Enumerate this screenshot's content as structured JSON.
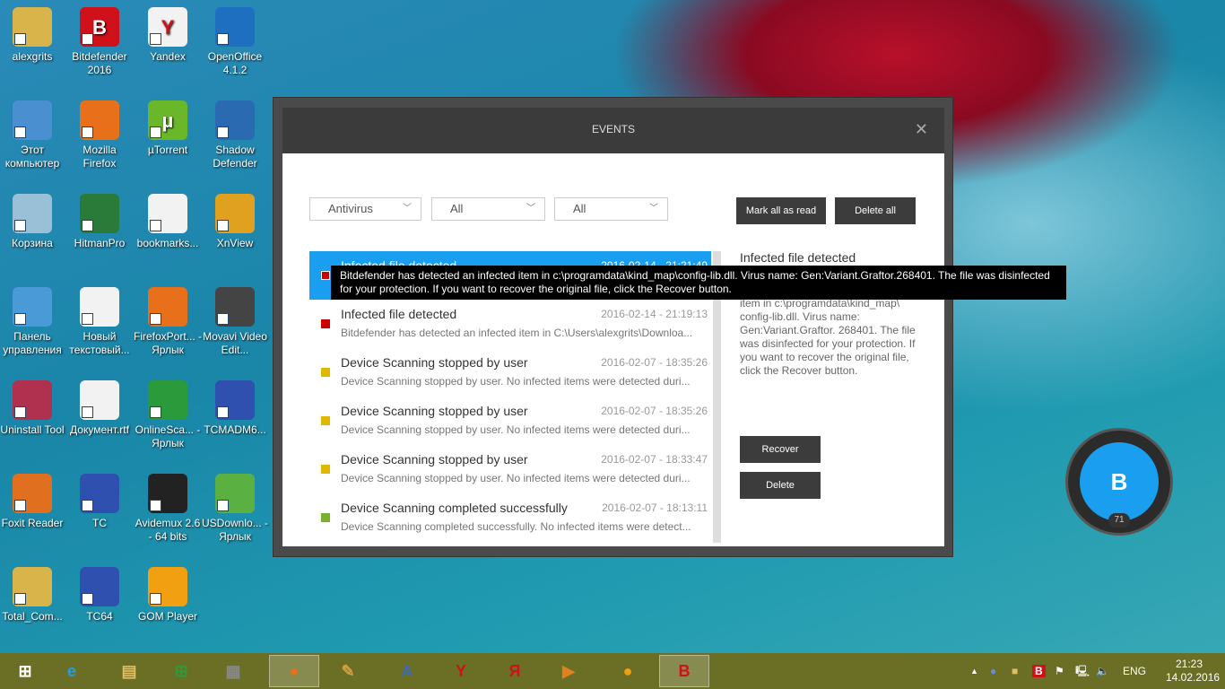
{
  "desktop": [
    {
      "label": "alexgrits",
      "color": "#d9b44a"
    },
    {
      "label": "Bitdefender 2016",
      "color": "#d0101a",
      "glyph": "B"
    },
    {
      "label": "Yandex",
      "color": "#f2f2f2",
      "glyph": "Y"
    },
    {
      "label": "OpenOffice 4.1.2",
      "color": "#1e6fc0"
    },
    {
      "label": "Этот компьютер",
      "color": "#4a8fd0"
    },
    {
      "label": "Mozilla Firefox",
      "color": "#e8701a"
    },
    {
      "label": "µTorrent",
      "color": "#6ab82a",
      "glyph": "µ"
    },
    {
      "label": "Shadow Defender",
      "color": "#2a6ab0"
    },
    {
      "label": "Корзина",
      "color": "#9ac0d8"
    },
    {
      "label": "HitmanPro",
      "color": "#2a7a3a"
    },
    {
      "label": "bookmarks...",
      "color": "#f2f2f2"
    },
    {
      "label": "XnView",
      "color": "#e0a020"
    },
    {
      "label": "Панель управления",
      "color": "#4a9ad8"
    },
    {
      "label": "Новый текстовый...",
      "color": "#f2f2f2"
    },
    {
      "label": "FirefoxPort... - Ярлык",
      "color": "#e8701a"
    },
    {
      "label": "Movavi Video Edit...",
      "color": "#444"
    },
    {
      "label": "Uninstall Tool",
      "color": "#b03050"
    },
    {
      "label": "Документ.rtf",
      "color": "#f2f2f2"
    },
    {
      "label": "OnlineSca... - Ярлык",
      "color": "#2a9a3a"
    },
    {
      "label": "TCMADM6...",
      "color": "#3050b0"
    },
    {
      "label": "Foxit Reader",
      "color": "#e07020"
    },
    {
      "label": "TC",
      "color": "#3050b0"
    },
    {
      "label": "Avidemux 2.6 - 64 bits",
      "color": "#222"
    },
    {
      "label": "USDownlo... - Ярлык",
      "color": "#5ab040"
    },
    {
      "label": "Total_Com...",
      "color": "#d9b44a"
    },
    {
      "label": "TC64",
      "color": "#3050b0"
    },
    {
      "label": "GOM Player",
      "color": "#f0a010"
    }
  ],
  "window": {
    "title": "EVENTS",
    "close": "✕",
    "filters": [
      {
        "value": "Antivirus"
      },
      {
        "value": "All"
      },
      {
        "value": "All"
      }
    ],
    "mark_all": "Mark all as read",
    "delete_all": "Delete all",
    "events": [
      {
        "title": "Infected file detected",
        "date": "2016-02-14 - 21:21:49",
        "summary": "Bitdefender has detected an infected item in c:\\programdata\\kind_map...",
        "severity": "#cc0000"
      },
      {
        "title": "Infected file detected",
        "date": "2016-02-14 - 21:19:13",
        "summary": "Bitdefender has detected an infected item in C:\\Users\\alexgrits\\Downloa...",
        "severity": "#cc0000"
      },
      {
        "title": "Device Scanning stopped by user",
        "date": "2016-02-07 - 18:35:26",
        "summary": "Device Scanning stopped by user. No infected items were detected duri...",
        "severity": "#e0b800"
      },
      {
        "title": "Device Scanning stopped by user",
        "date": "2016-02-07 - 18:35:26",
        "summary": "Device Scanning stopped by user. No infected items were detected duri...",
        "severity": "#e0b800"
      },
      {
        "title": "Device Scanning stopped by user",
        "date": "2016-02-07 - 18:33:47",
        "summary": "Device Scanning stopped by user. No infected items were detected duri...",
        "severity": "#e0b800"
      },
      {
        "title": "Device Scanning completed successfully",
        "date": "2016-02-07 - 18:13:11",
        "summary": "Device Scanning completed successfully. No infected items were detect...",
        "severity": "#7ab030"
      }
    ],
    "detail": {
      "title": "Infected file detected",
      "body": "Bitdefender has detected an infected item in c:\\programdata\\kind_map\\ config-lib.dll. Virus name: Gen:Variant.Graftor. 268401. The file was disinfected for your protection. If you want to recover the original file, click the Recover button.",
      "recover": "Recover",
      "delete": "Delete"
    },
    "tooltip": "Bitdefender has detected an infected item in c:\\programdata\\kind_map\\config-lib.dll. Virus name: Gen:Variant.Graftor.268401. The file was disinfected for your protection. If you want to recover the original file, click the Recover button."
  },
  "gadget": {
    "letter": "B",
    "count": "71"
  },
  "taskbar": {
    "apps": [
      {
        "name": "internet-explorer",
        "glyph": "e",
        "color": "#2a9ae0"
      },
      {
        "name": "file-explorer",
        "glyph": "▤",
        "color": "#e0c060"
      },
      {
        "name": "store",
        "glyph": "⊞",
        "color": "#2a9a3a"
      },
      {
        "name": "app",
        "glyph": "▦",
        "color": "#888"
      },
      {
        "name": "firefox",
        "glyph": "●",
        "color": "#e8701a"
      },
      {
        "name": "paint",
        "glyph": "✎",
        "color": "#d0a040"
      },
      {
        "name": "wordpad",
        "glyph": "A",
        "color": "#3a6ac0"
      },
      {
        "name": "yandex",
        "glyph": "Y",
        "color": "#d0101a"
      },
      {
        "name": "yandex-browser",
        "glyph": "Я",
        "color": "#d0101a"
      },
      {
        "name": "movavi",
        "glyph": "▶",
        "color": "#e08020"
      },
      {
        "name": "gom-player",
        "glyph": "●",
        "color": "#f0a010"
      },
      {
        "name": "bitdefender",
        "glyph": "B",
        "color": "#d0101a"
      }
    ],
    "lang": "ENG",
    "time": "21:23",
    "date": "14.02.2016"
  }
}
